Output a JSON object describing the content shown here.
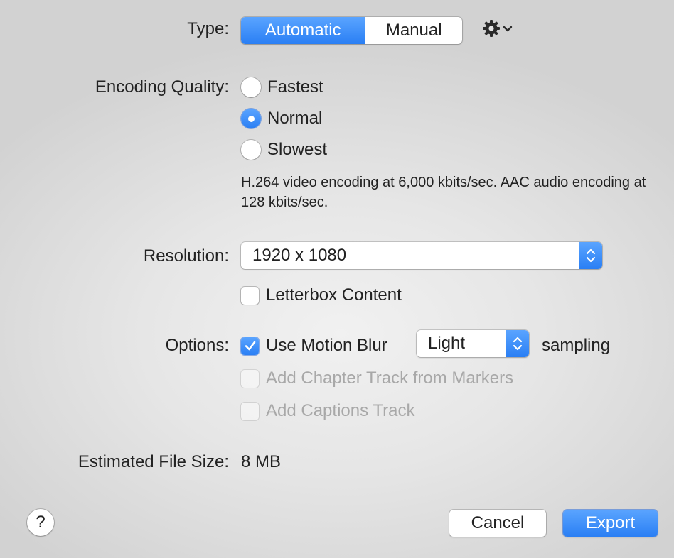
{
  "type": {
    "label": "Type:",
    "options": [
      "Automatic",
      "Manual"
    ],
    "selected": "Automatic",
    "gear_icon": "gear-icon",
    "chevron_icon": "chevron-down-icon"
  },
  "encoding_quality": {
    "label": "Encoding Quality:",
    "options": [
      {
        "label": "Fastest",
        "checked": false
      },
      {
        "label": "Normal",
        "checked": true
      },
      {
        "label": "Slowest",
        "checked": false
      }
    ],
    "description": "H.264 video encoding at 6,000 kbits/sec.  AAC audio encoding at 128 kbits/sec."
  },
  "resolution": {
    "label": "Resolution:",
    "value": "1920 x 1080",
    "letterbox": {
      "label": "Letterbox Content",
      "checked": false
    }
  },
  "options": {
    "label": "Options:",
    "motion_blur": {
      "label": "Use Motion Blur",
      "checked": true
    },
    "sampling_value": "Light",
    "sampling_suffix": "sampling",
    "chapter_track": {
      "label": "Add Chapter Track from Markers",
      "checked": false,
      "enabled": false
    },
    "captions_track": {
      "label": "Add Captions Track",
      "checked": false,
      "enabled": false
    }
  },
  "file_size": {
    "label": "Estimated File Size:",
    "value": "8 MB"
  },
  "buttons": {
    "help": "?",
    "cancel": "Cancel",
    "export": "Export"
  },
  "colors": {
    "accent": "#3b8ff8",
    "disabled_text": "#a8a8a8"
  }
}
